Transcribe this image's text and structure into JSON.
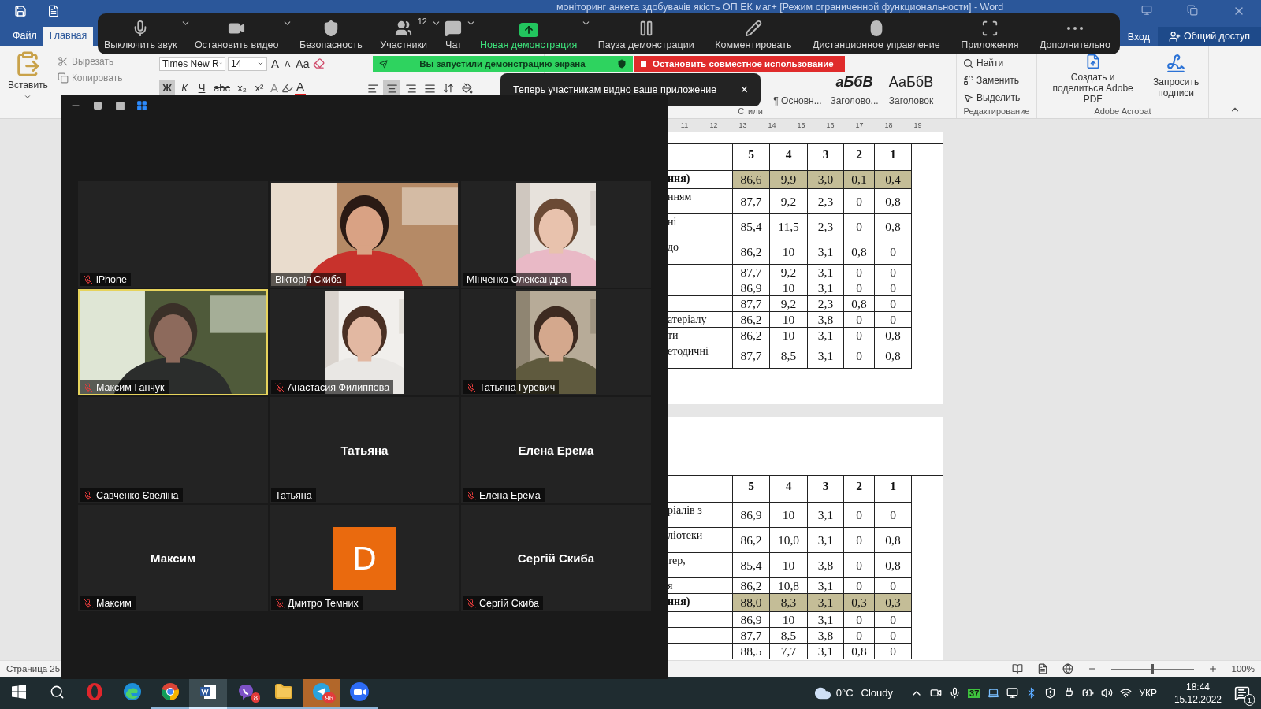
{
  "word": {
    "title": "моніторинг анкета здобувачів якість ОП ЕК маг+ [Режим ограниченной функциональности] - Word",
    "tabs": [
      {
        "label": "Файл",
        "selected": false
      },
      {
        "label": "Главная",
        "selected": true
      }
    ],
    "sign_in": "Вход",
    "share": "Общий доступ",
    "clipboard": {
      "paste": "Вставить",
      "cut": "Вырезать",
      "copy": "Копировать"
    },
    "font": {
      "name": "Times New R",
      "size": "14",
      "grow": "A",
      "shrink": "A",
      "case": "Aa",
      "format_buttons": [
        {
          "label": "Ж",
          "kind": "bold",
          "selected": true
        },
        {
          "label": "К",
          "kind": "italic",
          "selected": false
        },
        {
          "label": "Ч",
          "kind": "underline",
          "selected": false
        },
        {
          "label": "abc",
          "kind": "strike",
          "selected": false
        },
        {
          "label": "x₂",
          "kind": "plain",
          "selected": false
        },
        {
          "label": "x²",
          "kind": "plain",
          "selected": false
        }
      ],
      "effects": "A",
      "color_button": "A"
    },
    "alignments": [
      {
        "kind": "left",
        "selected": false
      },
      {
        "kind": "center",
        "selected": true
      },
      {
        "kind": "right",
        "selected": false
      },
      {
        "kind": "justify",
        "selected": false
      }
    ],
    "styles": {
      "cells": [
        {
          "label": "¶ Основн..."
        },
        {
          "sample": "аБбВ",
          "label": "Заголово..."
        },
        {
          "sample": "АаБбВ",
          "label": "Заголовок"
        }
      ],
      "group": "Стили"
    },
    "editing": {
      "find": "Найти",
      "replace": "Заменить",
      "select": "Выделить",
      "group": "Редактирование"
    },
    "acrobat": {
      "create": "Создать и поделиться Adobe PDF",
      "request": "Запросить подписи",
      "group": "Adobe Acrobat"
    },
    "ruler_marks": [
      "11",
      "12",
      "13",
      "14",
      "15",
      "16",
      "17",
      "18",
      "19"
    ],
    "tables": [
      {
        "header": [
          "5",
          "4",
          "3",
          "2",
          "1"
        ],
        "rows": [
          {
            "label": "ння)",
            "kind": "short",
            "highlighted": true,
            "values": [
              "86,6",
              "9,9",
              "3,0",
              "0,1",
              "0,4"
            ]
          },
          {
            "label": "нням",
            "kind": "tall",
            "highlighted": false,
            "values": [
              "87,7",
              "9,2",
              "2,3",
              "0",
              "0,8"
            ]
          },
          {
            "label": "ні",
            "kind": "tall",
            "highlighted": false,
            "values": [
              "85,4",
              "11,5",
              "2,3",
              "0",
              "0,8"
            ]
          },
          {
            "label": "до",
            "kind": "tall",
            "highlighted": false,
            "values": [
              "86,2",
              "10",
              "3,1",
              "0,8",
              "0"
            ]
          },
          {
            "kind": "short",
            "highlighted": false,
            "values": [
              "87,7",
              "9,2",
              "3,1",
              "0",
              "0"
            ]
          },
          {
            "kind": "short",
            "highlighted": false,
            "values": [
              "86,9",
              "10",
              "3,1",
              "0",
              "0"
            ]
          },
          {
            "kind": "short",
            "highlighted": false,
            "values": [
              "87,7",
              "9,2",
              "2,3",
              "0,8",
              "0"
            ]
          },
          {
            "label": "атеріалу",
            "kind": "short",
            "highlighted": false,
            "values": [
              "86,2",
              "10",
              "3,8",
              "0",
              "0"
            ]
          },
          {
            "label": "ти",
            "kind": "short",
            "highlighted": false,
            "values": [
              "86,2",
              "10",
              "3,1",
              "0",
              "0,8"
            ]
          },
          {
            "label": "етодичні",
            "kind": "tall",
            "highlighted": false,
            "values": [
              "87,7",
              "8,5",
              "3,1",
              "0",
              "0,8"
            ]
          }
        ]
      },
      {
        "header": [
          "5",
          "4",
          "3",
          "2",
          "1"
        ],
        "rows": [
          {
            "label": "ріалів з",
            "kind": "tall",
            "highlighted": false,
            "values": [
              "86,9",
              "10",
              "3,1",
              "0",
              "0"
            ]
          },
          {
            "label": "ліотеки",
            "kind": "tall",
            "highlighted": false,
            "values": [
              "86,2",
              "10,0",
              "3,1",
              "0",
              "0,8"
            ]
          },
          {
            "label": "тер,",
            "kind": "tall",
            "highlighted": false,
            "values": [
              "85,4",
              "10",
              "3,8",
              "0",
              "0,8"
            ]
          },
          {
            "label": "я",
            "kind": "short",
            "highlighted": false,
            "values": [
              "86,2",
              "10,8",
              "3,1",
              "0",
              "0"
            ]
          },
          {
            "label": "ння)",
            "kind": "short",
            "highlighted": true,
            "values": [
              "88,0",
              "8,3",
              "3,1",
              "0,3",
              "0,3"
            ]
          },
          {
            "kind": "short",
            "highlighted": false,
            "values": [
              "86,9",
              "10",
              "3,1",
              "0",
              "0"
            ]
          },
          {
            "kind": "short",
            "highlighted": false,
            "values": [
              "87,7",
              "8,5",
              "3,8",
              "0",
              "0"
            ]
          },
          {
            "kind": "short",
            "highlighted": false,
            "values": [
              "88,5",
              "7,7",
              "3,1",
              "0,8",
              "0"
            ]
          }
        ]
      }
    ],
    "status": {
      "page": "Страница 25",
      "zoom": "100%",
      "zoom_slider": {
        "level": 0.5
      }
    }
  },
  "meeting": {
    "toolbar": [
      {
        "kind": "mute",
        "label": "Выключить звук",
        "menu": true
      },
      {
        "kind": "video",
        "label": "Остановить видео",
        "menu": true
      },
      {
        "kind": "security",
        "label": "Безопасность",
        "menu": false
      },
      {
        "kind": "participants",
        "label": "Участники",
        "count": "12",
        "menu": true
      },
      {
        "kind": "chat",
        "label": "Чат",
        "menu": true
      },
      {
        "kind": "share",
        "label": "Новая демонстрация",
        "menu": true
      },
      {
        "kind": "pause",
        "label": "Пауза демонстрации",
        "menu": false
      },
      {
        "kind": "annotate",
        "label": "Комментировать",
        "menu": false
      },
      {
        "kind": "remote",
        "label": "Дистанционное управление",
        "menu": false
      },
      {
        "kind": "apps",
        "label": "Приложения",
        "menu": false
      },
      {
        "kind": "more",
        "label": "Дополнительно",
        "menu": false
      }
    ],
    "banner": "Вы запустили демонстрацию экрана",
    "stop": "Остановить совместное использование",
    "tooltip": {
      "text": "Теперь участникам видно ваше приложение",
      "close": "×"
    },
    "gallery": {
      "view_buttons": [
        {
          "kind": "minimize",
          "selected": false
        },
        {
          "kind": "single",
          "selected": false
        },
        {
          "kind": "split",
          "selected": false
        },
        {
          "kind": "grid",
          "selected": true
        }
      ],
      "tiles": [
        {
          "kind": "blank",
          "name": "iPhone",
          "muted": true,
          "speaking": false
        },
        {
          "kind": "video",
          "name": "Вікторія Скиба",
          "muted": false,
          "speaking": false
        },
        {
          "kind": "portrait",
          "name": "Мінченко Олександра",
          "muted": false,
          "speaking": false
        },
        {
          "kind": "video",
          "name": "Максим Ганчук",
          "muted": true,
          "speaking": true
        },
        {
          "kind": "portrait",
          "name": "Анастасия Филиппова",
          "muted": true,
          "speaking": false
        },
        {
          "kind": "portrait",
          "name": "Татьяна Гуревич",
          "muted": true,
          "speaking": false
        },
        {
          "kind": "blank",
          "name": "Савченко Євеліна",
          "muted": true,
          "speaking": false
        },
        {
          "kind": "name",
          "display": "Татьяна",
          "name": "Татьяна",
          "muted": false,
          "speaking": false
        },
        {
          "kind": "name",
          "display": "Елена Ерема",
          "name": "Елена Ерема",
          "muted": true,
          "speaking": false
        },
        {
          "kind": "name",
          "display": "Максим",
          "name": "Максим",
          "muted": true,
          "speaking": false
        },
        {
          "kind": "avatar",
          "letter": "D",
          "name": "Дмитро Темних",
          "muted": true,
          "speaking": false
        },
        {
          "kind": "name",
          "display": "Сергій Скиба",
          "name": "Сергій Скиба",
          "muted": true,
          "speaking": false
        }
      ]
    }
  },
  "taskbar": {
    "apps": [
      {
        "kind": "opera",
        "open": false,
        "selected": false,
        "flashing": false
      },
      {
        "kind": "edge",
        "open": false,
        "selected": false,
        "flashing": false
      },
      {
        "kind": "chrome",
        "open": true,
        "selected": false,
        "flashing": false
      },
      {
        "kind": "word",
        "open": true,
        "selected": true,
        "flashing": false
      },
      {
        "kind": "viber",
        "open": true,
        "selected": false,
        "flashing": false,
        "badge": "8"
      },
      {
        "kind": "explorer",
        "open": true,
        "selected": false,
        "flashing": false
      },
      {
        "kind": "telegram",
        "open": true,
        "selected": false,
        "flashing": true,
        "badge": "96"
      },
      {
        "kind": "zoom",
        "open": true,
        "selected": false,
        "flashing": false
      }
    ],
    "temperature": "0°C",
    "weather": "Cloudy",
    "tray_counter": "37",
    "language": "УКР",
    "time": "18:44",
    "date": "15.12.2022",
    "notifications": "1"
  }
}
